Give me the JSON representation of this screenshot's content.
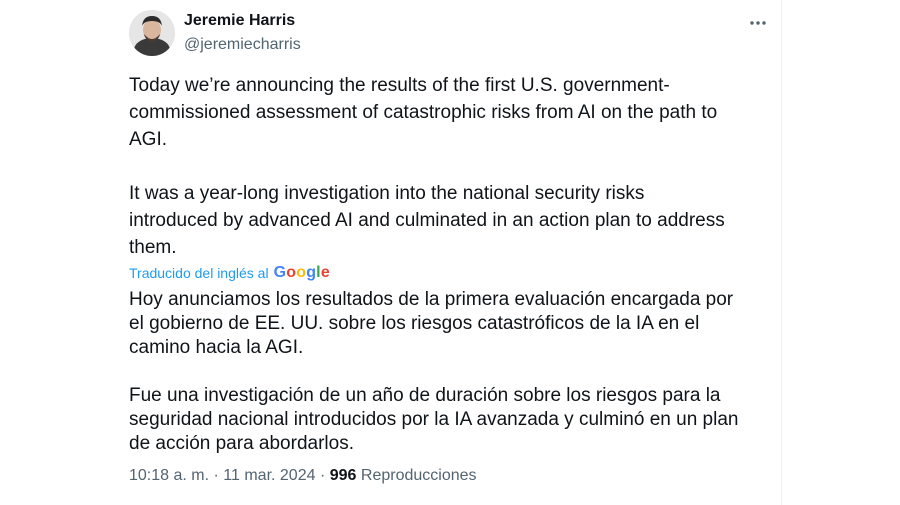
{
  "author": {
    "name": "Jeremie Harris",
    "handle": "@jeremiecharris"
  },
  "tweet": {
    "original_text": "Today we’re announcing the results of the first U.S. government-\ncommissioned assessment of catastrophic risks from AI on the path to\nAGI.\n\nIt was a year-long investigation into the national security risks\nintroduced by advanced AI and culminated in an action plan to address\nthem.",
    "translated_by_label": "Traducido del inglés al",
    "translated_by_logo_text": "Google",
    "translated_text": "Hoy anunciamos los resultados de la primera evaluación encargada por\nel gobierno de EE. UU. sobre los riesgos catastróficos de la IA en el\ncamino hacia la AGI.\n\nFue una investigación de un año de duración sobre los riesgos para la\nseguridad nacional introducidos por la IA avanzada y culminó en un plan\nde acción para abordarlos."
  },
  "meta": {
    "time": "10:18 a. m.",
    "separator": "·",
    "date": "11 mar. 2024",
    "views_count": "996",
    "views_label": "Reproducciones"
  },
  "icons": {
    "more": "more-horizontal-icon",
    "avatar": "avatar"
  },
  "colors": {
    "link": "#1d9bf0",
    "secondary_text": "#536471",
    "primary_text": "#0f1419"
  }
}
